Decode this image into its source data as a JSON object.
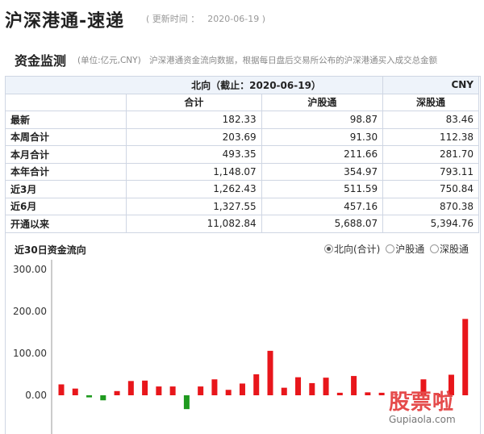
{
  "header": {
    "title": "沪深港通-速递",
    "update_label": "( 更新时间 ：",
    "update_date": "2020-06-19 )"
  },
  "section": {
    "title": "资金监测",
    "desc": "(单位:亿元,CNY)　沪深港通资金流向数据，根据每日盘后交易所公布的沪深港通买入成交总金额"
  },
  "table": {
    "caption": "北向（截止：2020-06-19）",
    "currency": "CNY",
    "columns": [
      "合计",
      "沪股通",
      "深股通"
    ],
    "rows": [
      {
        "label": "最新",
        "values": [
          "182.33",
          "98.87",
          "83.46"
        ]
      },
      {
        "label": "本周合计",
        "values": [
          "203.69",
          "91.30",
          "112.38"
        ]
      },
      {
        "label": "本月合计",
        "values": [
          "493.35",
          "211.66",
          "281.70"
        ]
      },
      {
        "label": "本年合计",
        "values": [
          "1,148.07",
          "354.97",
          "793.11"
        ]
      },
      {
        "label": "近3月",
        "values": [
          "1,262.43",
          "511.59",
          "750.84"
        ]
      },
      {
        "label": "近6月",
        "values": [
          "1,327.55",
          "457.16",
          "870.38"
        ]
      },
      {
        "label": "开通以来",
        "values": [
          "11,082.84",
          "5,688.07",
          "5,394.76"
        ]
      }
    ]
  },
  "chart_section": {
    "title": "近30日资金流向",
    "options": [
      {
        "label": "北向(合计)",
        "checked": true
      },
      {
        "label": "沪股通",
        "checked": false
      },
      {
        "label": "深股通",
        "checked": false
      }
    ]
  },
  "colors": {
    "positive": "#e8161b",
    "negative": "#1f9a1f",
    "accent_header": "#eef3fa"
  },
  "chart_data": {
    "type": "bar",
    "ylim": [
      -45,
      300
    ],
    "yticks": [
      "300.00",
      "200.00",
      "100.00",
      "0.00"
    ],
    "values": [
      26,
      16,
      -5,
      -12,
      10,
      34,
      35,
      21,
      21,
      -33,
      21,
      38,
      13,
      28,
      50,
      106,
      18,
      43,
      29,
      42,
      6,
      46,
      7,
      6,
      2,
      3,
      38,
      4,
      49,
      182
    ]
  },
  "watermark": {
    "text": "股票啦",
    "url": "Gupiaola.com"
  }
}
